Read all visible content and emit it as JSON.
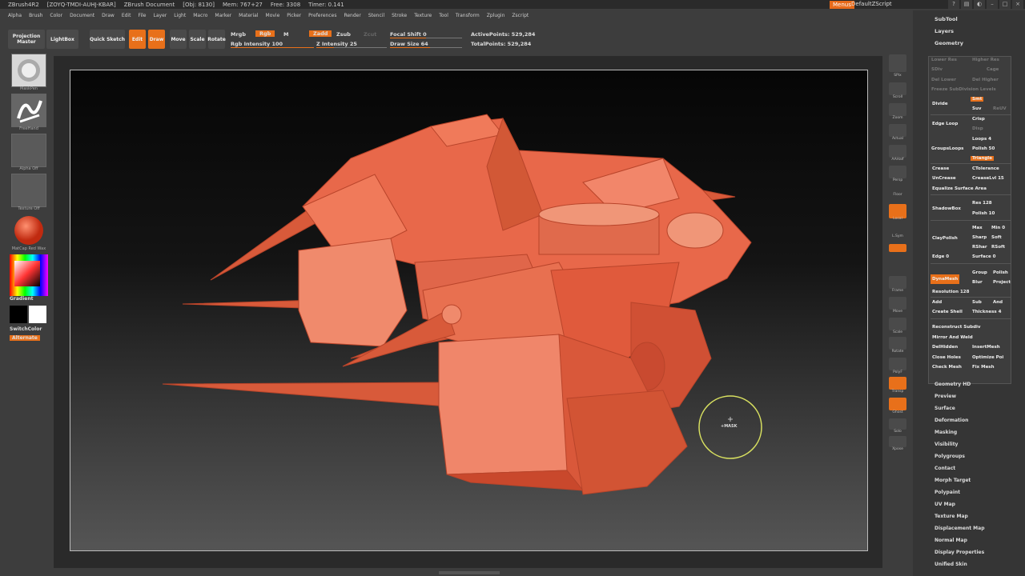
{
  "titlebar": {
    "app": "ZBrush4R2",
    "serial": "[ZOYQ-TMDI-AUHJ-KBAR]",
    "document": "ZBrush Document",
    "obj": "[Obj: 8130]",
    "mem": "Mem: 767+27",
    "free": "Free: 3308",
    "timer": "Timer: 0.141",
    "menus_label": "Menus",
    "script_label": "DefaultZScript"
  },
  "menubar": [
    "Alpha",
    "Brush",
    "Color",
    "Document",
    "Draw",
    "Edit",
    "File",
    "Layer",
    "Light",
    "Macro",
    "Marker",
    "Material",
    "Movie",
    "Picker",
    "Preferences",
    "Render",
    "Stencil",
    "Stroke",
    "Texture",
    "Tool",
    "Transform",
    "Zplugin",
    "Zscript"
  ],
  "shelf": {
    "projection_master": "Projection Master",
    "lightbox": "LightBox",
    "quick_sketch": "Quick Sketch",
    "edit": "Edit",
    "draw": "Draw",
    "move": "Move",
    "scale": "Scale",
    "rotate": "Rotate",
    "mrgb": "Mrgb",
    "rgb": "Rgb",
    "m": "M",
    "rgb_intensity": "Rgb Intensity 100",
    "zadd": "Zadd",
    "zsub": "Zsub",
    "zcut": "Zcut",
    "z_intensity": "Z Intensity 25",
    "focal_shift": "Focal Shift 0",
    "draw_size": "Draw Size 64",
    "active_points": "ActivePoints: 529,284",
    "total_points": "TotalPoints: 529,284"
  },
  "lefttray": {
    "brush": "MaskPen",
    "stroke": "FreeHand",
    "alpha": "Alpha Off",
    "texture": "Texture Off",
    "material": "MatCap Red Wax",
    "gradient": "Gradient",
    "switchcolor": "SwitchColor",
    "alternate": "Alternate"
  },
  "canvas": {
    "cursor_label": "+MASK"
  },
  "righttools": [
    "SPix",
    "Scroll",
    "Zoom",
    "Actual",
    "AAHalf",
    "Persp",
    "Floor",
    "Local",
    "L.Sym",
    "Xyz",
    "Frame",
    "Move",
    "Scale",
    "Rotate",
    "PolyF",
    "Transp",
    "Ghost",
    "Solo",
    "Xpose"
  ],
  "rightpanel": {
    "subtool": "SubTool",
    "layers": "Layers",
    "geometry": "Geometry",
    "lower_res": "Lower Res",
    "higher_res": "Higher Res",
    "sdiv": "SDiv",
    "cage": "Cage",
    "del_lower": "Del Lower",
    "del_higher": "Del Higher",
    "freeze_subdiv": "Freeze SubDivision Levels",
    "divide": "Divide",
    "smt": "Smt",
    "suv": "Suv",
    "reuv": "ReUV",
    "edge_loop": "Edge Loop",
    "crisp": "Crisp",
    "disp": "Disp",
    "grouploops": "GroupsLoops",
    "loops": "Loops 4",
    "polish": "Polish 50",
    "triangle": "Triangle",
    "crease": "Crease",
    "ctolerance": "CTolerance",
    "uncrease": "UnCrease",
    "creaselvl": "CreaseLvl 15",
    "equalize": "Equalize Surface Area",
    "shadowbox": "ShadowBox",
    "res": "Res 128",
    "polish10": "Polish 10",
    "claypolish": "ClayPolish",
    "max": "Max",
    "min": "Min 0",
    "sharp": "Sharp",
    "soft": "Soft",
    "rsharp": "RShar",
    "rsoft": "RSoft",
    "edge": "Edge 0",
    "surface": "Surface 0",
    "dynamesh": "DynaMesh",
    "group": "Group",
    "polish_b": "Polish",
    "blur": "Blur",
    "project": "Project",
    "resolution": "Resolution 128",
    "add": "Add",
    "sub": "Sub",
    "and": "And",
    "create_shell": "Create Shell",
    "thickness": "Thickness 4",
    "reconstruct": "Reconstruct Subdiv",
    "mirror_weld": "Mirror And Weld",
    "delhidden": "DelHidden",
    "insertmesh": "InsertMesh",
    "close_holes": "Close Holes",
    "optimize": "Optimize Poi",
    "check_mesh": "Check Mesh",
    "fix_mesh": "Fix Mesh",
    "submenus": [
      "Geometry HD",
      "Preview",
      "Surface",
      "Deformation",
      "Masking",
      "Visibility",
      "Polygroups",
      "Contact",
      "Morph Target",
      "Polypaint",
      "UV Map",
      "Texture Map",
      "Displacement Map",
      "Normal Map",
      "Display Properties",
      "Unified Skin"
    ]
  },
  "colors": {
    "accent": "#e8701a",
    "model": "#e8684a"
  }
}
